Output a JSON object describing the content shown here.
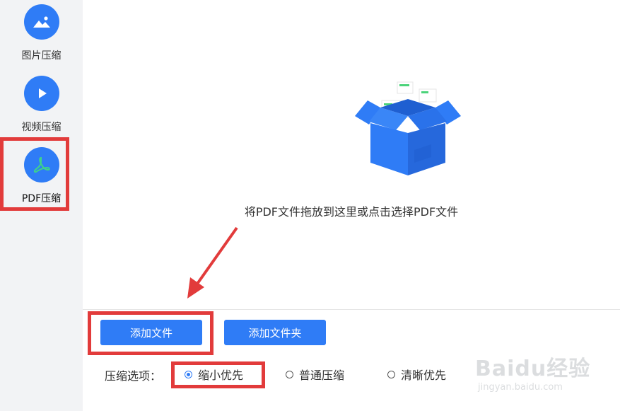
{
  "sidebar": {
    "items": [
      {
        "label": "图片压缩",
        "icon": "image-icon"
      },
      {
        "label": "视频压缩",
        "icon": "play-icon"
      },
      {
        "label": "PDF压缩",
        "icon": "pdf-icon",
        "active": true
      }
    ]
  },
  "main": {
    "drop_hint": "将PDF文件拖放到这里或点击选择PDF文件",
    "drop_icon": "open-box-icon"
  },
  "actions": {
    "add_file": "添加文件",
    "add_folder": "添加文件夹"
  },
  "compress_options": {
    "label": "压缩选项：",
    "options": [
      {
        "label": "缩小优先",
        "checked": true
      },
      {
        "label": "普通压缩",
        "checked": false
      },
      {
        "label": "清晰优先",
        "checked": false
      }
    ]
  },
  "watermark": {
    "brand": "Baidu经验",
    "url": "jingyan.baidu.com"
  },
  "colors": {
    "accent": "#2f7cf6",
    "sidebar_bg": "#f2f3f5",
    "highlight_red": "#e23b3b"
  }
}
